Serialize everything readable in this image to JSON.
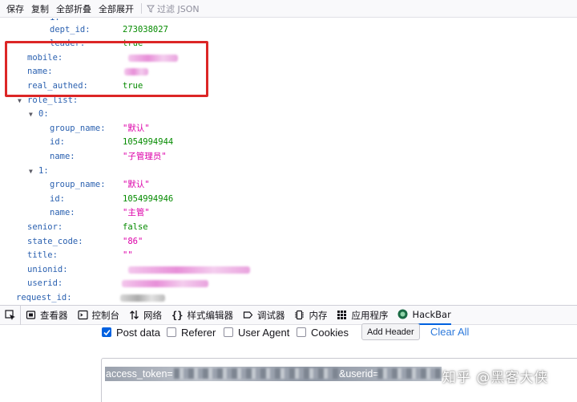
{
  "toolbar": {
    "save": "保存",
    "copy": "复制",
    "collapse_all": "全部折叠",
    "expand_all": "全部展开",
    "filter_placeholder": "过滤 JSON"
  },
  "json_tree": {
    "dept_id_key": "dept_id:",
    "dept_id_value": "273038027",
    "leader_key": "leader:",
    "leader_value": "true",
    "mobile_key": "mobile:",
    "name_key": "name:",
    "real_authed_key": "real_authed:",
    "real_authed_value": "true",
    "role_list_key": "role_list:",
    "role0_index": "0:",
    "role0_group_name_key": "group_name:",
    "role0_group_name_value": "\"默认\"",
    "role0_id_key": "id:",
    "role0_id_value": "1054994944",
    "role0_name_key": "name:",
    "role0_name_value": "\"子管理员\"",
    "role1_index": "1:",
    "role1_group_name_key": "group_name:",
    "role1_group_name_value": "\"默认\"",
    "role1_id_key": "id:",
    "role1_id_value": "1054994946",
    "role1_name_key": "name:",
    "role1_name_value": "\"主管\"",
    "senior_key": "senior:",
    "senior_value": "false",
    "state_code_key": "state_code:",
    "state_code_value": "\"86\"",
    "title_key": "title:",
    "title_value": "\"\"",
    "unionid_key": "unionid:",
    "userid_key": "userid:",
    "request_id_key": "request_id:"
  },
  "devtools_tabs": {
    "inspector": "查看器",
    "console": "控制台",
    "network": "网络",
    "style_editor": "样式编辑器",
    "debugger": "调试器",
    "memory": "内存",
    "application": "应用程序",
    "hackbar": "HackBar"
  },
  "hackbar": {
    "post_data_label": "Post data",
    "post_data_checked": true,
    "referer_label": "Referer",
    "user_agent_label": "User Agent",
    "cookies_label": "Cookies",
    "add_header_label": "Add Header",
    "clear_all_label": "Clear All",
    "body_access_token": "access_token=",
    "body_userid": "&userid="
  },
  "watermark": "知乎 @黑客大侠",
  "colors": {
    "json_key": "#2b61b0",
    "json_number": "#058b00",
    "json_string": "#dd00a9",
    "highlight": "#dc2626",
    "accent": "#0061e0",
    "link": "#2f7bdc"
  }
}
